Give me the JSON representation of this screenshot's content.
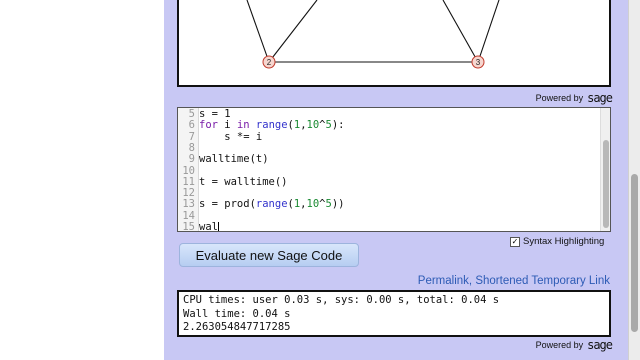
{
  "graph": {
    "vertices": [
      {
        "label": "2"
      },
      {
        "label": "3"
      }
    ]
  },
  "powered_by": {
    "text": "Powered by",
    "logo": "sage"
  },
  "editor": {
    "lines": [
      {
        "num": "5",
        "text": "s = 1"
      },
      {
        "num": "6",
        "text": "for i in range(1,10^5):"
      },
      {
        "num": "7",
        "text": "    s *= i"
      },
      {
        "num": "8",
        "text": ""
      },
      {
        "num": "9",
        "text": "walltime(t)"
      },
      {
        "num": "10",
        "text": ""
      },
      {
        "num": "11",
        "text": "t = walltime()"
      },
      {
        "num": "12",
        "text": ""
      },
      {
        "num": "13",
        "text": "s = prod(range(1,10^5))"
      },
      {
        "num": "14",
        "text": ""
      },
      {
        "num": "15",
        "text": "wal"
      }
    ]
  },
  "syntax_highlighting": {
    "label": "Syntax Highlighting",
    "checked": true,
    "check_glyph": "✓"
  },
  "evaluate_button": {
    "label": "Evaluate new Sage Code"
  },
  "links": {
    "permalink": "Permalink",
    "separator": ",",
    "shortened": "Shortened Temporary Link"
  },
  "output": {
    "lines": [
      "CPU times: user 0.03 s, sys: 0.00 s, total: 0.04 s",
      "Wall time: 0.04 s",
      "2.263054847717285"
    ]
  },
  "colors": {
    "page_background": "#c8c8f4",
    "link": "#2d5bb5",
    "vertex_stroke": "#c0392b",
    "vertex_fill": "#f6d6cf"
  }
}
